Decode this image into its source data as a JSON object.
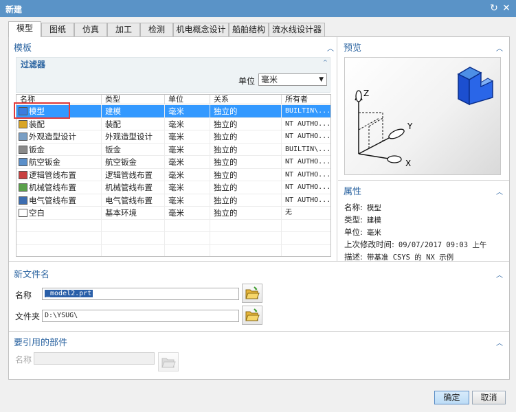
{
  "window": {
    "title": "新建",
    "refresh_icon": "refresh-icon",
    "close_icon": "close-icon"
  },
  "tabs": [
    {
      "label": "模型",
      "active": true
    },
    {
      "label": "图纸"
    },
    {
      "label": "仿真"
    },
    {
      "label": "加工"
    },
    {
      "label": "检测"
    },
    {
      "label": "机电概念设计"
    },
    {
      "label": "船舶结构"
    },
    {
      "label": "流水线设计器"
    }
  ],
  "templates": {
    "title": "模板",
    "filter_title": "过滤器",
    "unit_label": "单位",
    "unit_value": "毫米",
    "columns": [
      "名称",
      "类型",
      "单位",
      "关系",
      "所有者"
    ],
    "rows": [
      {
        "name": "模型",
        "type": "建模",
        "unit": "毫米",
        "relation": "独立的",
        "owner": "BUILTIN\\...",
        "selected": true
      },
      {
        "name": "装配",
        "type": "装配",
        "unit": "毫米",
        "relation": "独立的",
        "owner": "NT AUTHO..."
      },
      {
        "name": "外观造型设计",
        "type": "外观造型设计",
        "unit": "毫米",
        "relation": "独立的",
        "owner": "NT AUTHO..."
      },
      {
        "name": "钣金",
        "type": "钣金",
        "unit": "毫米",
        "relation": "独立的",
        "owner": "BUILTIN\\..."
      },
      {
        "name": "航空钣金",
        "type": "航空钣金",
        "unit": "毫米",
        "relation": "独立的",
        "owner": "NT AUTHO..."
      },
      {
        "name": "逻辑管线布置",
        "type": "逻辑管线布置",
        "unit": "毫米",
        "relation": "独立的",
        "owner": "NT AUTHO..."
      },
      {
        "name": "机械管线布置",
        "type": "机械管线布置",
        "unit": "毫米",
        "relation": "独立的",
        "owner": "NT AUTHO..."
      },
      {
        "name": "电气管线布置",
        "type": "电气管线布置",
        "unit": "毫米",
        "relation": "独立的",
        "owner": "NT AUTHO..."
      },
      {
        "name": "空白",
        "type": "基本环境",
        "unit": "毫米",
        "relation": "独立的",
        "owner": "无"
      }
    ]
  },
  "preview": {
    "title": "预览",
    "axis_x": "X",
    "axis_y": "Y",
    "axis_z": "Z"
  },
  "properties": {
    "title": "属性",
    "lines": [
      {
        "label": "名称:",
        "value": "模型"
      },
      {
        "label": "类型:",
        "value": "建模"
      },
      {
        "label": "单位:",
        "value": "毫米"
      },
      {
        "label": "上次修改时间:",
        "value": "09/07/2017 09:03 上午"
      },
      {
        "label": "描述:",
        "value": "带基准 CSYS 的 NX 示例"
      }
    ]
  },
  "new_file": {
    "title": "新文件名",
    "name_label": "名称",
    "name_value": "_model2.prt",
    "folder_label": "文件夹",
    "folder_value": "D:\\YSUG\\"
  },
  "referenced": {
    "title": "要引用的部件",
    "name_label": "名称",
    "name_value": ""
  },
  "buttons": {
    "ok": "确定",
    "cancel": "取消"
  }
}
